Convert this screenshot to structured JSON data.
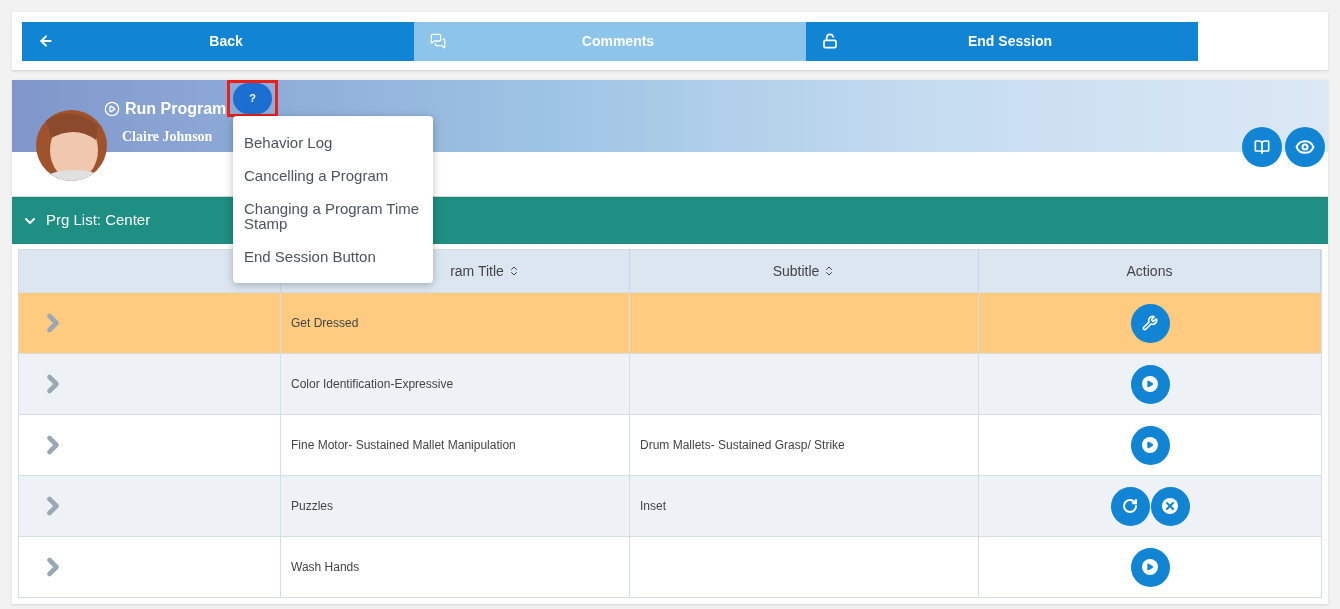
{
  "toolbar": [
    {
      "kind": "back",
      "label": "Back",
      "disabled": false
    },
    {
      "kind": "comments",
      "label": "Comments",
      "disabled": true
    },
    {
      "kind": "end",
      "label": "End Session",
      "disabled": false
    }
  ],
  "header": {
    "title": "Run Program",
    "student": "Claire Johnson",
    "help_button": {
      "label": "?",
      "highlighted": true
    },
    "actions": [
      {
        "kind": "book"
      },
      {
        "kind": "eye"
      }
    ]
  },
  "help_menu": [
    "Behavior Log",
    "Cancelling a Program",
    "Changing a Program Time Stamp",
    "End Session Button"
  ],
  "list": {
    "title": "Prg List: Center",
    "expanded": true
  },
  "table": {
    "columns": [
      {
        "sortable": false
      },
      {
        "label": "ram Title",
        "sortable": true
      },
      {
        "label": "Subtitle",
        "sortable": true
      },
      {
        "label": "Actions",
        "sortable": false
      }
    ],
    "rows": [
      {
        "title": "Get Dressed",
        "selected": true,
        "actions": [
          {
            "kind": "settings"
          }
        ]
      },
      {
        "title": "Color Identification-Expressive",
        "selected": false,
        "actions": [
          {
            "kind": "play"
          }
        ]
      },
      {
        "title": "Fine Motor- Sustained Mallet Manipulation",
        "subtitle": "Drum Mallets- Sustained Grasp/ Strike",
        "selected": false,
        "actions": [
          {
            "kind": "play"
          }
        ]
      },
      {
        "title": "Puzzles",
        "subtitle": "Inset",
        "selected": false,
        "actions": [
          {
            "kind": "restart"
          },
          {
            "kind": "cancel"
          }
        ]
      },
      {
        "title": "Wash Hands",
        "selected": false,
        "actions": [
          {
            "kind": "play"
          }
        ]
      }
    ]
  }
}
